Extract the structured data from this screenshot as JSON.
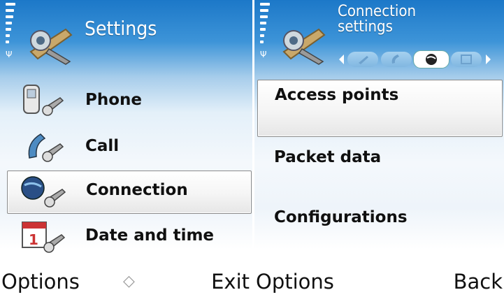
{
  "left_screen": {
    "title": "Settings",
    "items": [
      {
        "label": "Phone",
        "icon": "phone-settings-icon"
      },
      {
        "label": "Call",
        "icon": "call-settings-icon"
      },
      {
        "label": "Connection",
        "icon": "connection-settings-icon"
      },
      {
        "label": "Date and time",
        "icon": "date-time-settings-icon"
      }
    ],
    "selected_index": 2,
    "softkeys": {
      "left": "Options",
      "center": "◇",
      "right": "Exit"
    }
  },
  "right_screen": {
    "title_line1": "Connection",
    "title_line2": "settings",
    "tabs": [
      "phone-tab-icon",
      "call-tab-icon",
      "connection-tab-icon",
      "datetime-tab-icon"
    ],
    "active_tab": 2,
    "items": [
      {
        "label": "Access points"
      },
      {
        "label": "Packet data"
      },
      {
        "label": "Configurations"
      }
    ],
    "selected_index": 0,
    "softkeys": {
      "left": "Options",
      "right": "Back"
    }
  },
  "colors": {
    "header_blue": "#1c78c8",
    "text": "#101010",
    "highlight_border": "#8a8a8a"
  }
}
